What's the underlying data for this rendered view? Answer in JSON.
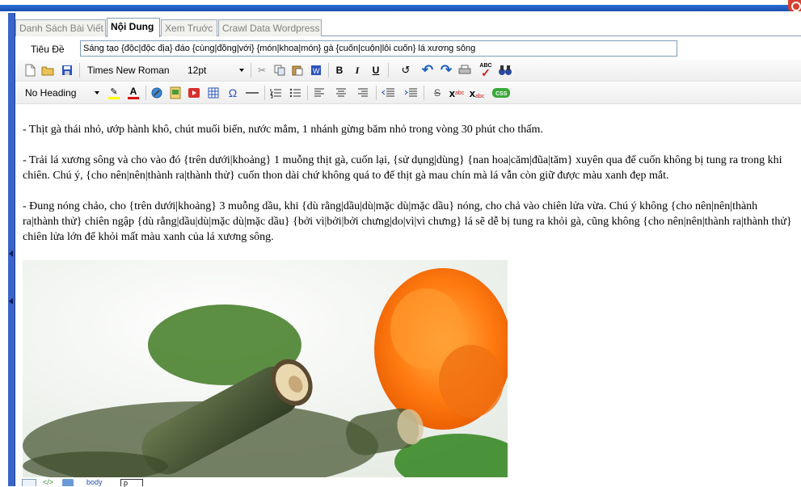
{
  "tabs": [
    {
      "label": "Danh Sách Bài Viết",
      "active": false
    },
    {
      "label": "Nội Dung",
      "active": true
    },
    {
      "label": "Xem Truớc",
      "active": false
    },
    {
      "label": "Crawl Data Wordpress",
      "active": false
    }
  ],
  "title_row": {
    "label": "Tiêu Đề",
    "value": "Sáng tạo {độc|độc địa} đáo {cùng|đồng|với} {món|khoa|món} gà {cuốn|cuộn|lôi cuốn} lá xương sông"
  },
  "toolbar": {
    "font_name": "Times New Roman",
    "font_size": "12pt",
    "heading": "No Heading",
    "spellcheck_letters": "ABC"
  },
  "content": {
    "paragraphs": [
      "- Thịt gà thái nhỏ, ướp hành khô, chút muối biển, nước mắm, 1 nhánh gừng băm nhỏ trong vòng 30 phút cho thấm.",
      "- Trải lá xương sông và cho vào đó {trên dưới|khoảng} 1 muỗng thịt gà, cuốn lại, {sử dụng|dùng} {nan hoa|căm|đũa|tăm} xuyên qua để cuốn không bị tung ra trong khi chiên. Chú ý, {cho nên|nên|thành ra|thành thử} cuốn thon dài chứ không quá to để thịt gà mau chín mà lá vẫn còn giữ được màu xanh đẹp mắt.",
      "- Đung nóng chảo, cho {trên dưới|khoảng} 3 muỗng dầu, khi {dù rằng|dầu|dù|mặc dù|mặc dầu} nóng, cho chả vào chiên lửa vừa. Chú ý không {cho nên|nên|thành ra|thành thử} chiên ngập {dù rằng|dầu|dù|mặc dù|mặc dầu} {bởi vì|bởi|bởi chưng|do|vì|vì chưng} lá sẽ dễ bị tung ra khỏi gà, cũng không {cho nên|nên|thành ra|thành thử} chiên lửa lớn để khỏi mất màu xanh của lá xương sông."
    ]
  },
  "status": {
    "path": "body",
    "tag": "p"
  },
  "colors": {
    "accent": "#3a64c8",
    "tab_border": "#7f9db9"
  }
}
